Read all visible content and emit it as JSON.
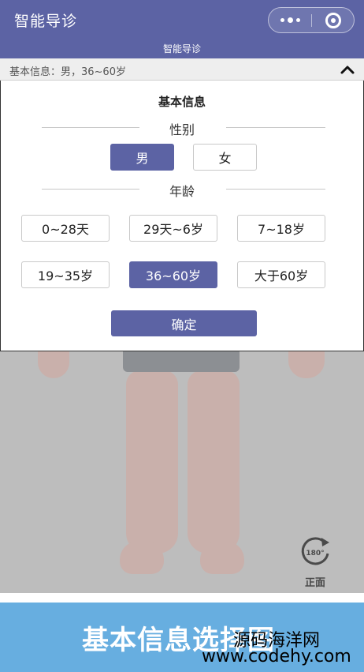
{
  "header": {
    "title": "智能导诊",
    "subtitle": "智能导诊"
  },
  "summary": {
    "text": "基本信息：男，36~60岁"
  },
  "panel": {
    "title": "基本信息",
    "gender_label": "性别",
    "gender_options": [
      {
        "label": "男",
        "selected": true
      },
      {
        "label": "女",
        "selected": false
      }
    ],
    "age_label": "年龄",
    "age_options": [
      {
        "label": "0~28天",
        "selected": false
      },
      {
        "label": "29天~6岁",
        "selected": false
      },
      {
        "label": "7~18岁",
        "selected": false
      },
      {
        "label": "19~35岁",
        "selected": false
      },
      {
        "label": "36~60岁",
        "selected": true
      },
      {
        "label": "大于60岁",
        "selected": false
      }
    ],
    "confirm_label": "确定"
  },
  "body_view": {
    "rotate_degrees": "180°",
    "view_label": "正面"
  },
  "banner": {
    "title": "基本信息选择图",
    "watermark_line1": "源码海洋网",
    "watermark_line2": "www.codehy.com"
  },
  "colors": {
    "primary": "#5c63a4",
    "banner": "#67aee0"
  }
}
